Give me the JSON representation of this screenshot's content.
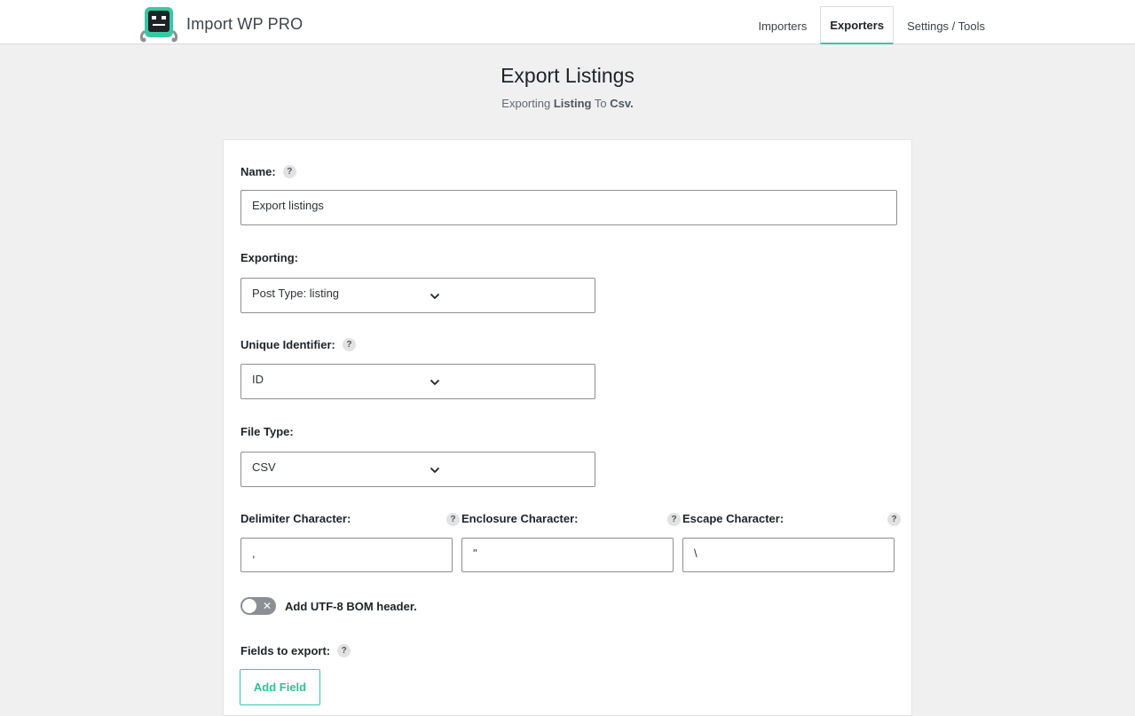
{
  "brand": {
    "name": "Import WP PRO",
    "logo_icon": "robot-icon",
    "accent_color": "#3ac7a4"
  },
  "nav": {
    "items": [
      {
        "label": "Importers",
        "active": false
      },
      {
        "label": "Exporters",
        "active": true
      },
      {
        "label": "Settings / Tools",
        "active": false
      }
    ]
  },
  "page": {
    "title": "Export Listings",
    "subtitle_prefix": "Exporting",
    "subtitle_entity": "Listing",
    "subtitle_mid": "To",
    "subtitle_format": "Csv."
  },
  "form": {
    "name": {
      "label": "Name:",
      "value": "Export listings"
    },
    "exporting": {
      "label": "Exporting:",
      "value": "Post Type: listing"
    },
    "unique_identifier": {
      "label": "Unique Identifier:",
      "value": "ID"
    },
    "file_type": {
      "label": "File Type:",
      "value": "CSV"
    },
    "delimiter": {
      "label": "Delimiter Character:",
      "value": ","
    },
    "enclosure": {
      "label": "Enclosure Character:",
      "value": "\""
    },
    "escape": {
      "label": "Escape Character:",
      "value": "\\"
    },
    "bom": {
      "label": "Add UTF-8 BOM header.",
      "enabled": false
    },
    "fields": {
      "label": "Fields to export:",
      "button_label": "Add Field"
    },
    "help_glyph": "?"
  }
}
